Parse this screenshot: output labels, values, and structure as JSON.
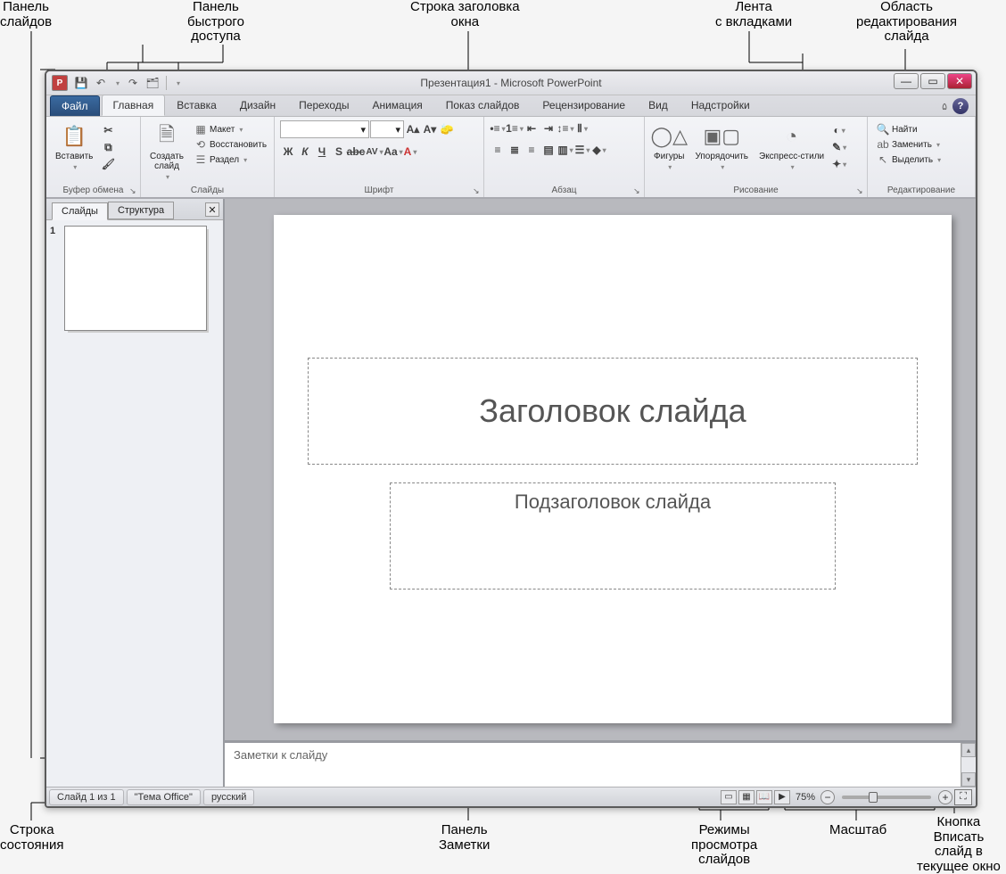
{
  "callouts": {
    "slide_panel": "Панель\nслайдов",
    "qat": "Панель\nбыстрого\nдоступа",
    "title_bar": "Строка заголовка\nокна",
    "ribbon": "Лента\nс вкладками",
    "edit_area": "Область\nредактирования\nслайда",
    "status_bar": "Строка\nсостояния",
    "notes_panel": "Панель\nЗаметки",
    "view_modes": "Режимы\nпросмотра\nслайдов",
    "zoom": "Масштаб",
    "fit": "Кнопка\nВписать\nслайд в\nтекущее окно"
  },
  "title": "Презентация1 - Microsoft PowerPoint",
  "tabs": {
    "file": "Файл",
    "home": "Главная",
    "insert": "Вставка",
    "design": "Дизайн",
    "transitions": "Переходы",
    "animation": "Анимация",
    "slideshow": "Показ слайдов",
    "review": "Рецензирование",
    "view": "Вид",
    "addins": "Надстройки"
  },
  "ribbonGroups": {
    "clipboard": {
      "label": "Буфер обмена",
      "paste": "Вставить"
    },
    "slides": {
      "label": "Слайды",
      "new": "Создать\nслайд",
      "layout": "Макет",
      "reset": "Восстановить",
      "section": "Раздел"
    },
    "font": {
      "label": "Шрифт"
    },
    "paragraph": {
      "label": "Абзац"
    },
    "drawing": {
      "label": "Рисование",
      "shapes": "Фигуры",
      "arrange": "Упорядочить",
      "quickstyles": "Экспресс-стили"
    },
    "editing": {
      "label": "Редактирование",
      "find": "Найти",
      "replace": "Заменить",
      "select": "Выделить"
    }
  },
  "panel": {
    "slides_tab": "Слайды",
    "outline_tab": "Структура",
    "thumb_num": "1"
  },
  "slide": {
    "title_placeholder": "Заголовок слайда",
    "subtitle_placeholder": "Подзаголовок слайда"
  },
  "notes": {
    "placeholder": "Заметки к слайду"
  },
  "status": {
    "slide_count": "Слайд 1 из 1",
    "theme": "\"Тема Office\"",
    "language": "русский",
    "zoom": "75%"
  }
}
